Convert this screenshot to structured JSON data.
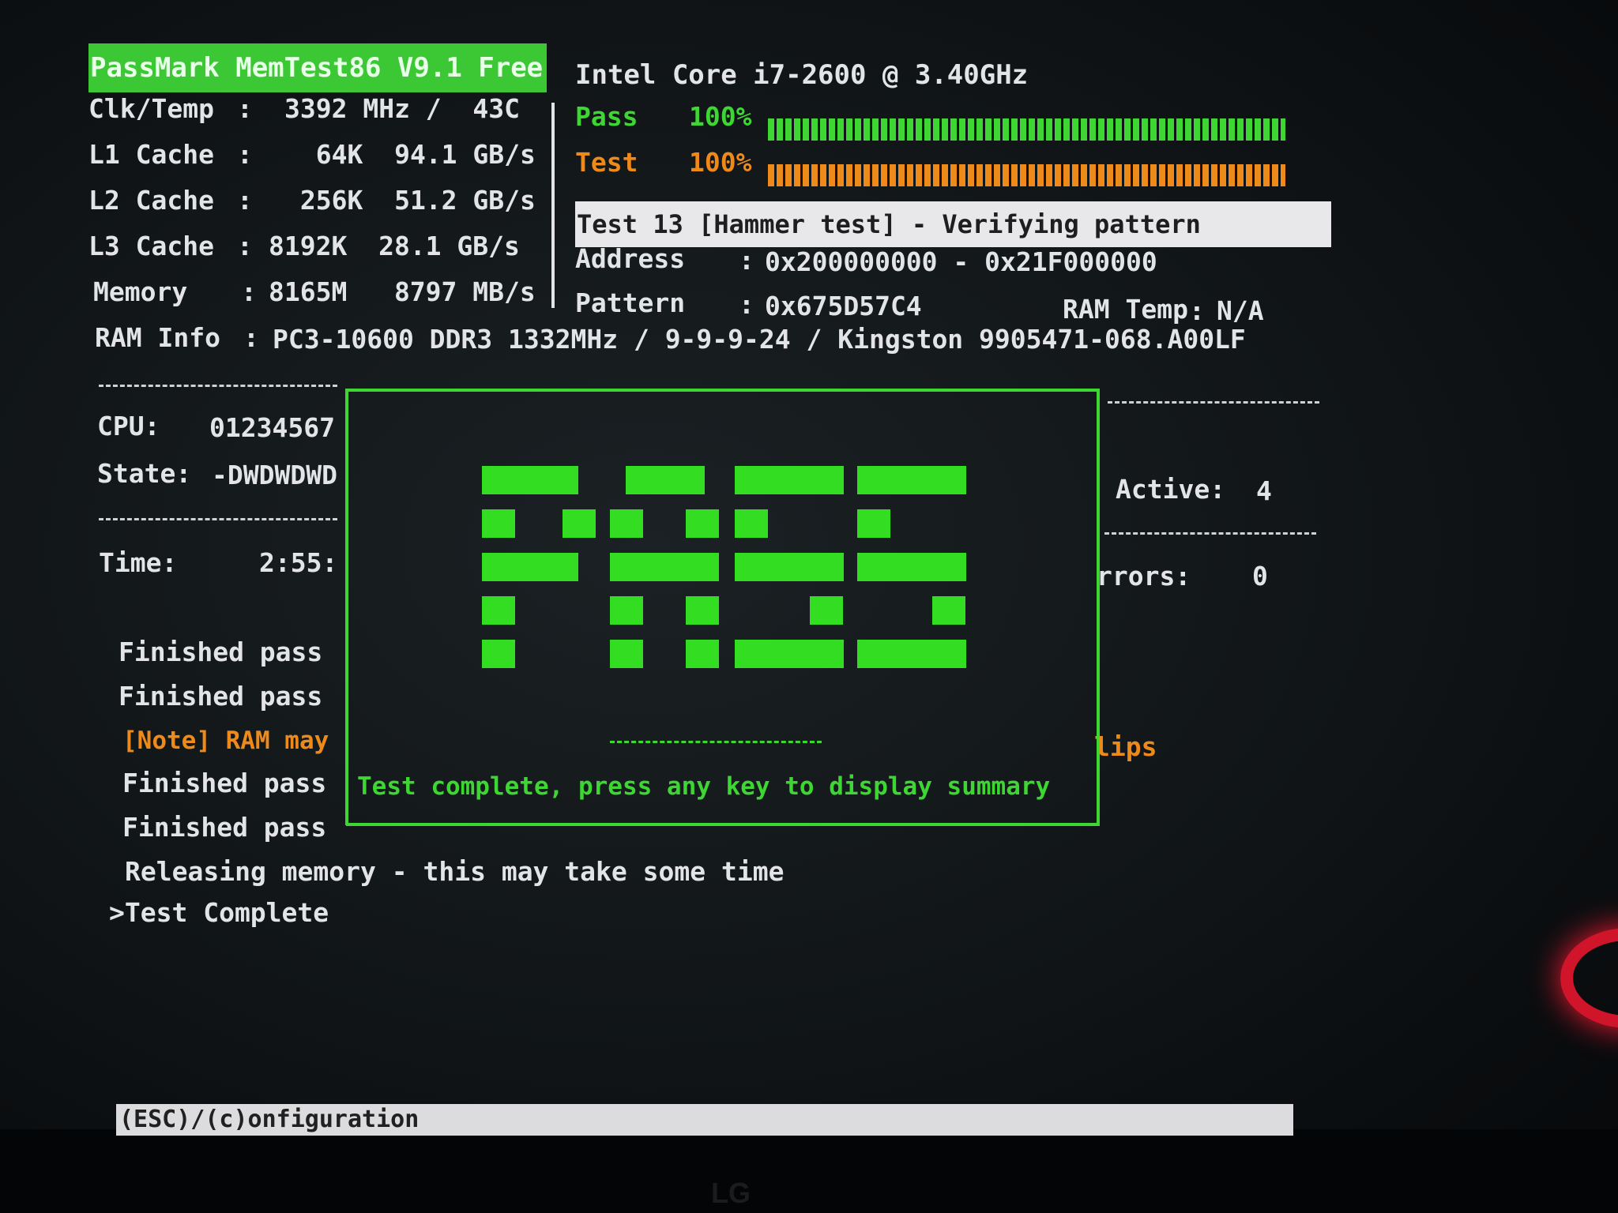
{
  "header": {
    "title": "PassMark MemTest86 V9.1 Free",
    "cpu_name": "Intel Core i7-2600 @ 3.40GHz"
  },
  "system_info": [
    {
      "label": "Clk/Temp",
      "value": "3392 MHz /  43C"
    },
    {
      "label": "L1 Cache",
      "value": "  64K  94.1 GB/s"
    },
    {
      "label": "L2 Cache",
      "value": " 256K  51.2 GB/s"
    },
    {
      "label": "L3 Cache",
      "value": "8192K  28.1 GB/s"
    },
    {
      "label": "Memory",
      "value": "8165M   8797 MB/s"
    }
  ],
  "ram_info": {
    "label": "RAM Info",
    "value": "PC3-10600 DDR3 1332MHz / 9-9-9-24 / Kingston 9905471-068.A00LF"
  },
  "progress": {
    "pass_label": "Pass",
    "pass_value": "100%",
    "pass_fraction": 1.0,
    "test_label": "Test",
    "test_value": "100%",
    "test_fraction": 1.0
  },
  "current_test": "Test 13 [Hammer test] - Verifying pattern",
  "address": {
    "label": "Address",
    "value": "0x200000000 - 0x21F000000"
  },
  "pattern": {
    "label": "Pattern",
    "value": "0x675D57C4"
  },
  "ram_temp": {
    "label": "RAM Temp",
    "value": "N/A"
  },
  "cpu_panel": {
    "cpu_label": "CPU:",
    "cpu_value": "01234567",
    "state_label": "State:",
    "state_value": "-DWDWDWD",
    "time_label": "Time:",
    "time_value": "2:55:"
  },
  "right_panel": {
    "active_label": "Active:",
    "active_value": "4",
    "errors_label": "rrors:",
    "errors_value": "0",
    "flips": "lips"
  },
  "log": [
    "Finished pass",
    "Finished pass",
    "[Note] RAM may",
    "Finished pass",
    "Finished pass",
    "Releasing memory - this may take some time",
    ">Test Complete"
  ],
  "popup": {
    "message": "Test complete, press any key to display summary"
  },
  "footer": {
    "shortcut": "(ESC)/(c)onfiguration"
  },
  "colors": {
    "green": "#3dd633",
    "orange": "#ee8a1a"
  }
}
